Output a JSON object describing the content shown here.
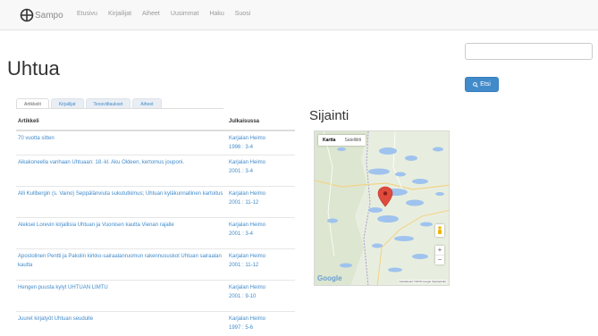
{
  "navbar": {
    "brand": "Sampo",
    "links": [
      "Etusivu",
      "Kirjailijat",
      "Aiheet",
      "Uusimmat",
      "Haku",
      "Suosi"
    ]
  },
  "search": {
    "value": "",
    "button_label": "Etsi"
  },
  "page": {
    "title": "Uhtua"
  },
  "tabs": [
    "Artikkelit",
    "Kirjailijat",
    "Teosviittaukset",
    "Aiheet"
  ],
  "table": {
    "headers": [
      "Artikkeli",
      "Julkaisussa"
    ],
    "rows": [
      {
        "title": "70 vuotta sitten",
        "source": "Karjalan Heimo",
        "date": "1996 : 3-4"
      },
      {
        "title": "Aikakoneella vanhaan Uhtuaan: 18.-kl. Aku Oldeen, kertomus jouponi.",
        "source": "Karjalan Heimo",
        "date": "2001 : 3-4"
      },
      {
        "title": "Alli Kullbergin (s. Vaino) Seppälänviuta sukututkimus; Uhtuan kyläkunnallinen kartoitus",
        "source": "Karjalan Heimo",
        "date": "2001 : 11-12"
      },
      {
        "title": "Aleksei Lorevin kirjallisia Uhtuan ja Vuonisen kautta Vienan rajalle",
        "source": "Karjalan Heimo",
        "date": "2001 : 3-4"
      },
      {
        "title": "Apostolinen Pentti ja Pakolin kirkko-sairaalanruomun rakennususkot Uhtuan sairaalan kautta",
        "source": "Karjalan Heimo",
        "date": "2001 : 11-12"
      },
      {
        "title": "Hengen puusta kylyt UHTUAN LIMTU",
        "source": "Karjalan Heimo",
        "date": "2001 : 9-10"
      },
      {
        "title": "Juuret kirjatyöt Uhtuan seudulle",
        "source": "Karjalan Heimo",
        "date": "1997 : 5-6"
      }
    ]
  },
  "location": {
    "heading": "Sijainti",
    "map_type_options": [
      "Kartta",
      "Satelliitti"
    ],
    "map_type_selected": "Kartta",
    "google_logo": "Google",
    "attribution": "Karttatiedot ©2015 Google   Käyttöehdot"
  },
  "colors": {
    "link": "#428bca",
    "button": "#428bca",
    "map_land": "#dfe9d3",
    "map_water": "#9fc3ee",
    "marker": "#e04b3e"
  },
  "icons": {
    "brand": "globe-logo-icon",
    "search_button": "search-icon",
    "map_marker": "map-marker-icon",
    "street_view": "pegman-icon",
    "zoom_in": "plus-icon",
    "zoom_out": "minus-icon"
  }
}
